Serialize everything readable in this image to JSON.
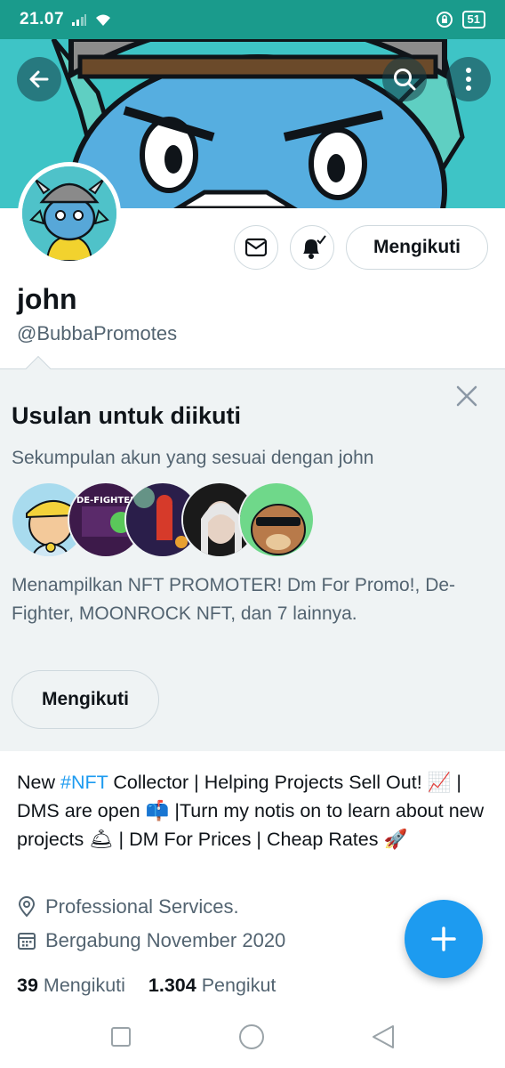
{
  "status_bar": {
    "time": "21.07",
    "battery": "51"
  },
  "header": {
    "back_icon": "arrow-left-icon",
    "search_icon": "search-icon",
    "more_icon": "more-vertical-icon"
  },
  "profile": {
    "name": "john",
    "handle": "@BubbaPromotes",
    "follow_label": "Mengikuti"
  },
  "suggestions": {
    "title": "Usulan untuk diikuti",
    "subtitle": "Sekumpulan akun yang sesuai dengan john",
    "description": "Menampilkan NFT PROMOTER! Dm For Promo!, De-Fighter, MOONROCK NFT, dan 7 lainnya.",
    "follow_label": "Mengikuti",
    "avatar_text": "DE-FIGHTER"
  },
  "bio": {
    "part1": "New ",
    "hashtag": "#NFT",
    "part2": " Collector | Helping Projects Sell Out! ",
    "emoji1": "📈",
    "part3": " | DMS are open ",
    "emoji2": "📫",
    "part4": " |Turn my notis on to learn about new projects ",
    "emoji3": "🛎",
    "part5": " | DM For Prices | Cheap Rates ",
    "emoji4": "🚀"
  },
  "meta": {
    "category": "Professional Services.",
    "joined": "Bergabung November 2020"
  },
  "stats": {
    "following_count": "39",
    "following_label": "Mengikuti",
    "followers_count": "1.304",
    "followers_label": "Pengikut"
  },
  "colors": {
    "accent": "#1d9bf0",
    "status_bar": "#1a9b8c",
    "banner": "#3ec4c6"
  }
}
